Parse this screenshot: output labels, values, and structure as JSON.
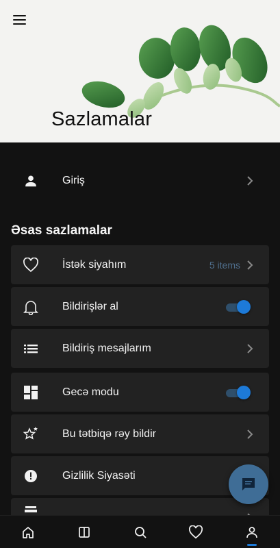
{
  "header": {
    "title": "Sazlamalar",
    "menu_icon": "hamburger-menu-icon"
  },
  "login": {
    "label": "Giriş",
    "icon": "person-icon"
  },
  "section": {
    "title": "Əsas sazlamalar"
  },
  "settings": [
    {
      "label": "İstək siyahım",
      "icon": "heart-outline-icon",
      "trailing": "5 items"
    },
    {
      "label": "Bildirişlər al",
      "icon": "bell-icon",
      "toggle": true
    },
    {
      "label": "Bildiriş mesajlarım",
      "icon": "list-icon"
    },
    {
      "label": "Gecə modu",
      "icon": "dashboard-icon",
      "toggle": true
    },
    {
      "label": "Bu tətbiqə rəy bildir",
      "icon": "star-outline-icon"
    },
    {
      "label": "Gizlilik Siyasəti",
      "icon": "alert-circle-icon"
    }
  ],
  "bottom_nav": [
    {
      "name": "home",
      "icon": "home-icon"
    },
    {
      "name": "split",
      "icon": "book-icon"
    },
    {
      "name": "search",
      "icon": "search-icon"
    },
    {
      "name": "favorites",
      "icon": "heart-icon"
    },
    {
      "name": "profile",
      "icon": "person-outline-icon",
      "active": true
    }
  ],
  "colors": {
    "background": "#121212",
    "card": "#222222",
    "accent": "#1d7ad8",
    "fab": "#3f6d96",
    "item_count": "#4f6e8c"
  }
}
